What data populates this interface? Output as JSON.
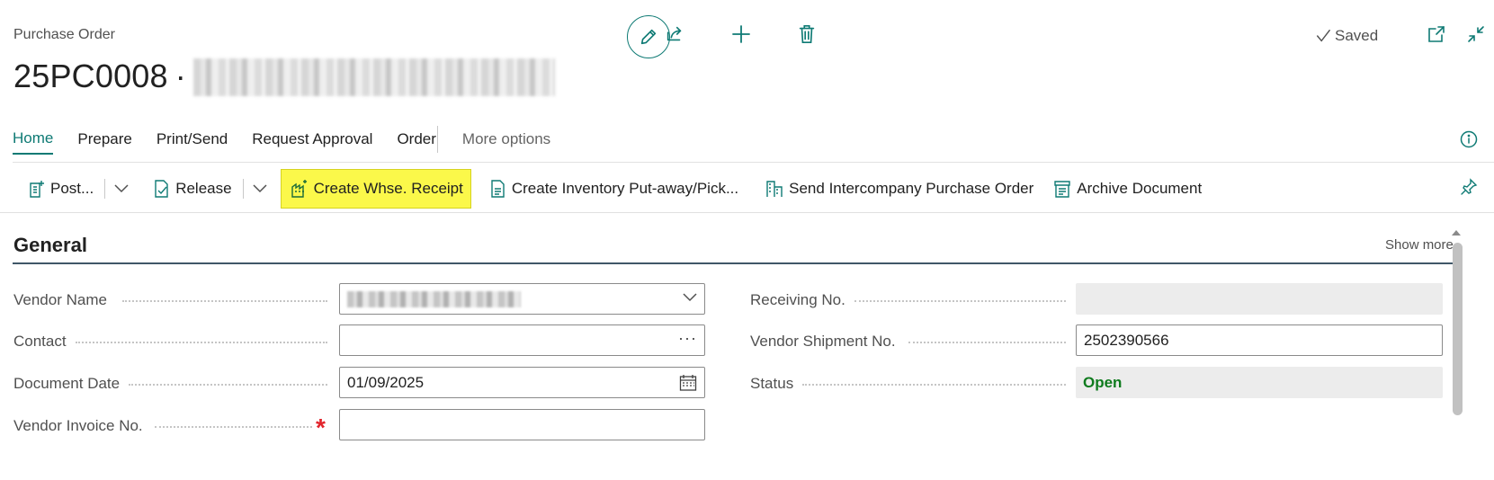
{
  "header": {
    "page_type": "Purchase Order",
    "document_no": "25PC0008",
    "title_separator": "·",
    "saved_label": "Saved"
  },
  "tabs": [
    {
      "label": "Home",
      "active": true
    },
    {
      "label": "Prepare"
    },
    {
      "label": "Print/Send"
    },
    {
      "label": "Request Approval"
    },
    {
      "label": "Order"
    }
  ],
  "more_options_label": "More options",
  "actions": {
    "post": "Post...",
    "release": "Release",
    "create_whse_receipt": "Create Whse. Receipt",
    "create_inventory": "Create Inventory Put-away/Pick...",
    "send_intercompany": "Send Intercompany Purchase Order",
    "archive": "Archive Document"
  },
  "section": {
    "title": "General",
    "show_more": "Show more"
  },
  "fields": {
    "vendor_name": {
      "label": "Vendor Name",
      "value": ""
    },
    "contact": {
      "label": "Contact",
      "value": ""
    },
    "document_date": {
      "label": "Document Date",
      "value": "01/09/2025"
    },
    "vendor_invoice_no": {
      "label": "Vendor Invoice No.",
      "value": "",
      "required": true
    },
    "receiving_no": {
      "label": "Receiving No.",
      "value": ""
    },
    "vendor_shipment_no": {
      "label": "Vendor Shipment No.",
      "value": "2502390566"
    },
    "status": {
      "label": "Status",
      "value": "Open"
    }
  },
  "icons": [
    "edit-icon",
    "share-icon",
    "plus-icon",
    "delete-icon",
    "check-icon",
    "open-new-window-icon",
    "collapse-icon",
    "info-icon",
    "post-icon",
    "release-icon",
    "whse-receipt-icon",
    "inventory-icon",
    "intercompany-icon",
    "archive-icon",
    "pin-icon",
    "chevron-down-icon",
    "ellipsis-icon",
    "calendar-icon"
  ],
  "colors": {
    "accent": "#0e7a74",
    "highlight": "#fbf84a",
    "status_open": "#0f7b1e",
    "required": "#e2242c"
  }
}
